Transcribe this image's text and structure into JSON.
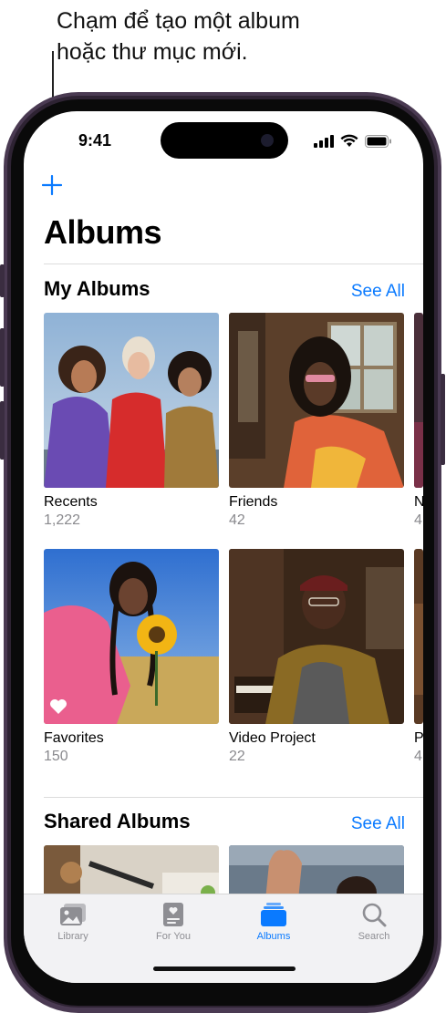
{
  "callout": {
    "line1": "Chạm để tạo một album",
    "line2": "hoặc thư mục mới."
  },
  "status": {
    "time": "9:41"
  },
  "header": {
    "title": "Albums"
  },
  "my_albums": {
    "title": "My Albums",
    "see_all": "See All",
    "items": [
      {
        "name": "Recents",
        "count": "1,222"
      },
      {
        "name": "Friends",
        "count": "42"
      },
      {
        "name": "N",
        "count": "4"
      },
      {
        "name": "Favorites",
        "count": "150"
      },
      {
        "name": "Video Project",
        "count": "22"
      },
      {
        "name": "P",
        "count": "4"
      }
    ]
  },
  "shared_albums": {
    "title": "Shared Albums",
    "see_all": "See All"
  },
  "tabbar": {
    "tabs": [
      {
        "label": "Library"
      },
      {
        "label": "For You"
      },
      {
        "label": "Albums"
      },
      {
        "label": "Search"
      }
    ],
    "active": "Albums"
  },
  "colors": {
    "accent": "#0a7aff",
    "frame": "#4a3a52"
  }
}
